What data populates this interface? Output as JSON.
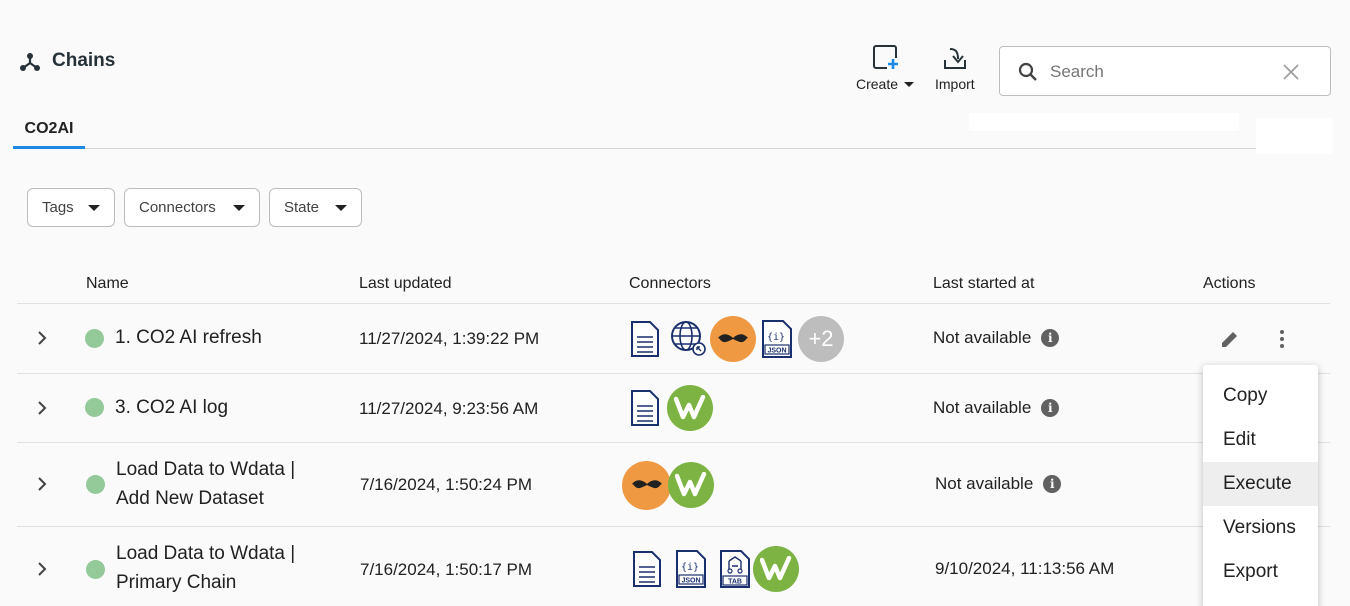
{
  "header": {
    "title": "Chains",
    "create_label": "Create",
    "import_label": "Import"
  },
  "search": {
    "placeholder": "Search",
    "value": ""
  },
  "tabs": [
    {
      "label": "CO2AI",
      "active": true
    }
  ],
  "filters": [
    {
      "label": "Tags"
    },
    {
      "label": "Connectors"
    },
    {
      "label": "State"
    }
  ],
  "table": {
    "columns": [
      "Name",
      "Last updated",
      "Connectors",
      "Last started at",
      "Actions"
    ],
    "rows": [
      {
        "name": "1. CO2 AI refresh",
        "last_updated": "11/27/2024, 1:39:22 PM",
        "connectors": [
          "document-icon",
          "web-icon",
          "mustache-icon",
          "json-icon"
        ],
        "more_count": "+2",
        "last_started": "Not available",
        "status_color": "#94c99a"
      },
      {
        "name": "3. CO2 AI log",
        "last_updated": "11/27/2024, 9:23:56 AM",
        "connectors": [
          "document-icon",
          "wdata-icon"
        ],
        "last_started": "Not available",
        "status_color": "#94c99a"
      },
      {
        "name_line1": "Load Data to Wdata |",
        "name_line2": "Add New Dataset",
        "last_updated": "7/16/2024, 1:50:24 PM",
        "connectors": [
          "mustache-icon",
          "wdata-icon"
        ],
        "last_started": "Not available",
        "status_color": "#94c99a"
      },
      {
        "name_line1": "Load Data to Wdata |",
        "name_line2": "Primary Chain",
        "last_updated": "7/16/2024, 1:50:17 PM",
        "connectors": [
          "document-icon",
          "json-icon",
          "tab-icon",
          "wdata-icon"
        ],
        "last_started": "9/10/2024, 11:13:56 AM",
        "status_color": "#94c99a"
      }
    ]
  },
  "icon_text": {
    "json": "JSON",
    "tab": "TAB",
    "json_brace": "{i}"
  },
  "info_glyph": "i",
  "context_menu": {
    "items": [
      {
        "label": "Copy"
      },
      {
        "label": "Edit"
      },
      {
        "label": "Execute",
        "active": true
      },
      {
        "label": "Versions"
      },
      {
        "label": "Export"
      }
    ]
  },
  "colors": {
    "accent": "#1e88e5",
    "status_ok": "#94c99a",
    "wdata_green": "#7cb342",
    "mustache_orange": "#ef9a42",
    "doc_navy": "#1a2f6e"
  }
}
